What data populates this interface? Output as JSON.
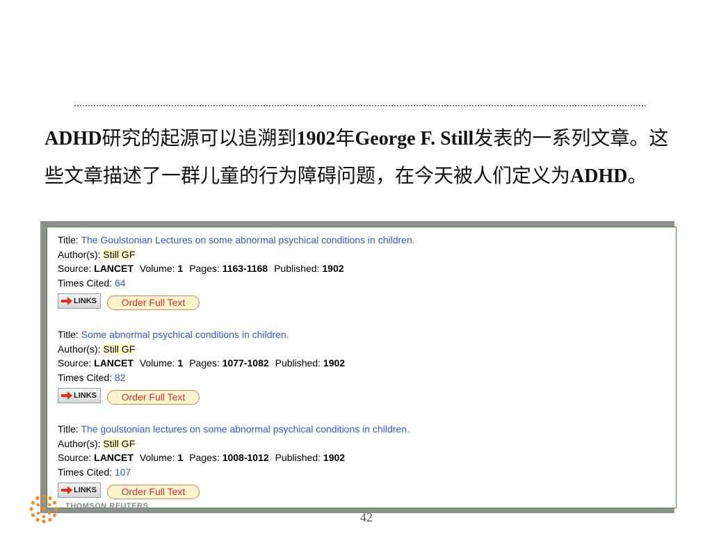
{
  "slide": {
    "heading_parts": [
      {
        "text": "ADHD",
        "bold": true
      },
      {
        "text": "研究的起源可以追溯到",
        "bold": false
      },
      {
        "text": "1902",
        "bold": true
      },
      {
        "text": "年",
        "bold": false
      },
      {
        "text": "George F. Still",
        "bold": true
      },
      {
        "text": "发表的一系列文章。这些文章描述了一群儿童的行为障碍问题，在今天被人们定义为",
        "bold": false
      },
      {
        "text": "ADHD",
        "bold": true
      },
      {
        "text": "。",
        "bold": false
      }
    ],
    "page_number": "42",
    "logo_text": "THOMSON REUTERS"
  },
  "labels": {
    "title": "Title:",
    "authors": "Author(s):",
    "source": "Source:",
    "volume": "Volume:",
    "pages": "Pages:",
    "published": "Published:",
    "times_cited": "Times Cited:",
    "links_button": "LINKS",
    "order_button": "Order Full Text"
  },
  "records": [
    {
      "title": "The Goulstonian Lectures on some abnormal psychical conditions in children.",
      "author": "Still GF",
      "source": "LANCET",
      "volume": "1",
      "pages": "1163-1168",
      "published": "1902",
      "times_cited": "64"
    },
    {
      "title": "Some abnormal psychical conditions in children.",
      "author": "Still GF",
      "source": "LANCET",
      "volume": "1",
      "pages": "1077-1082",
      "published": "1902",
      "times_cited": "82"
    },
    {
      "title": "The goulstonian lectures on some abnormal psychical conditions in children.",
      "author": "Still GF",
      "source": "LANCET",
      "volume": "1",
      "pages": "1008-1012",
      "published": "1902",
      "times_cited": "107"
    }
  ],
  "colors": {
    "link": "#3258c9",
    "author_highlight": "#ffffcc",
    "order_text": "#c8342c",
    "panel_border": "#3c9a3c",
    "logo_orange": "#f28a1e"
  },
  "icons": {
    "links_arrow": "arrow-right-icon",
    "logo": "thomson-reuters-logo"
  }
}
